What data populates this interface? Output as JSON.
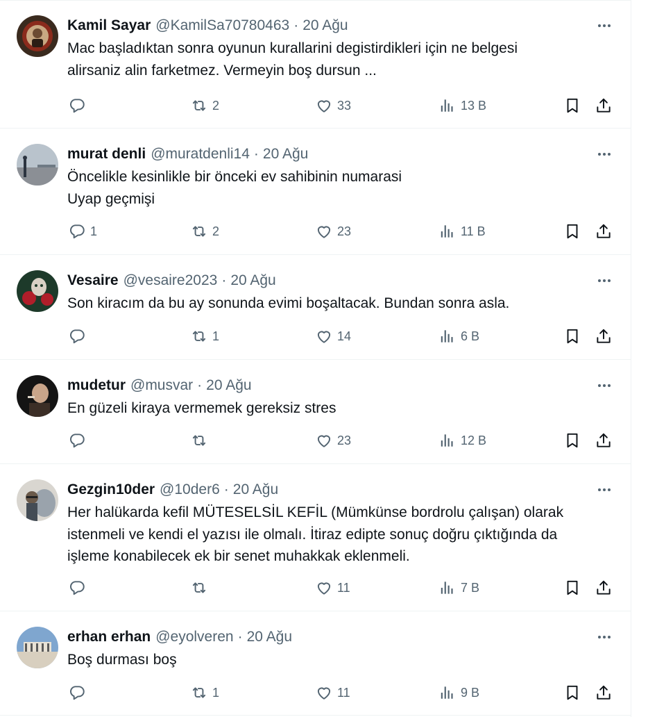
{
  "tweets": [
    {
      "name": "Kamil Sayar",
      "handle": "@KamilSa70780463",
      "separator": "·",
      "date": "20 Ağu",
      "lines": [
        "Mac başladıktan sonra oyunun kurallarini degistirdikleri için ne belgesi",
        "alirsaniz alin farketmez. Vermeyin boş dursun ..."
      ],
      "replies": "",
      "retweets": "2",
      "likes": "33",
      "views": "13 B",
      "avatar_colors": [
        "#3a2a1e",
        "#c8a882",
        "#8a2b1c"
      ]
    },
    {
      "name": "murat denli",
      "handle": "@muratdenli14",
      "separator": "·",
      "date": "20 Ağu",
      "lines": [
        "Öncelikle kesinlikle bir önceki ev sahibinin numarasi",
        "Uyap geçmişi"
      ],
      "replies": "1",
      "retweets": "2",
      "likes": "23",
      "views": "11 B",
      "avatar_colors": [
        "#b9c3cc",
        "#8b8f95",
        "#2c3440"
      ]
    },
    {
      "name": "Vesaire",
      "handle": "@vesaire2023",
      "separator": "·",
      "date": "20 Ağu",
      "lines": [
        "Son kiracım da bu ay sonunda evimi boşaltacak. Bundan sonra asla."
      ],
      "replies": "",
      "retweets": "1",
      "likes": "14",
      "views": "6 B",
      "avatar_colors": [
        "#1d3a2a",
        "#d8d0c4",
        "#b01e2a"
      ]
    },
    {
      "name": "mudetur",
      "handle": "@musvar",
      "separator": "·",
      "date": "20 Ağu",
      "lines": [
        "En güzeli kiraya vermemek gereksiz stres"
      ],
      "replies": "",
      "retweets": "",
      "likes": "23",
      "views": "12 B",
      "avatar_colors": [
        "#141414",
        "#c9a58a",
        "#3b2e26"
      ]
    },
    {
      "name": "Gezgin10der",
      "handle": "@10der6",
      "separator": "·",
      "date": "20 Ağu",
      "lines": [
        "Her halükarda kefil MÜTESELSİL KEFİL (Mümkünse bordrolu çalışan) olarak",
        "istenmeli ve kendi el yazısı ile olmalı. İtiraz edipte sonuç doğru çıktığında da",
        "işleme konabilecek ek bir senet muhakkak eklenmeli."
      ],
      "replies": "",
      "retweets": "",
      "likes": "11",
      "views": "7 B",
      "avatar_colors": [
        "#9aa3ac",
        "#6b5a4a",
        "#d9d6d0"
      ]
    },
    {
      "name": "erhan erhan",
      "handle": "@eyolveren",
      "separator": "·",
      "date": "20 Ağu",
      "lines": [
        "Boş durması boş"
      ],
      "replies": "",
      "retweets": "1",
      "likes": "11",
      "views": "9 B",
      "avatar_colors": [
        "#7fa6cf",
        "#d8cfbf",
        "#5a5a5a"
      ]
    }
  ],
  "colors": {
    "text": "#0f1419",
    "muted": "#536471",
    "border": "#eff3f4"
  },
  "icons": [
    "reply-icon",
    "retweet-icon",
    "like-icon",
    "views-icon",
    "bookmark-icon",
    "share-icon",
    "more-icon"
  ]
}
